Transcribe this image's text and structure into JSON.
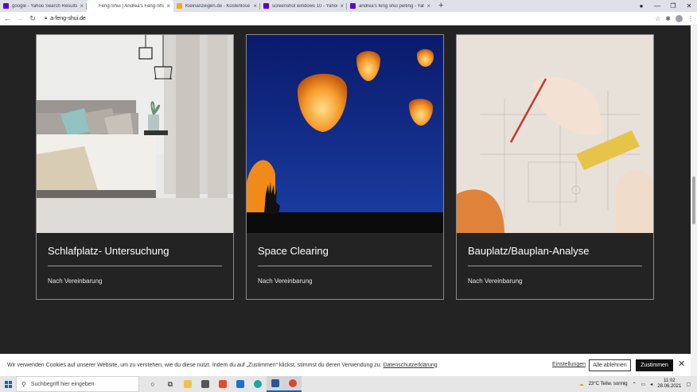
{
  "browser": {
    "tabs": [
      {
        "title": "google - Yahoo Search Results Yc",
        "icon": "yahoo-favicon",
        "active": false
      },
      {
        "title": "Feng-Shui | Andrea's Feng-Shui-",
        "icon": "site-favicon",
        "active": true
      },
      {
        "title": "Kleinanzeigen.de - Kostenlose Kl",
        "icon": "kleinanzeigen-favicon",
        "active": false
      },
      {
        "title": "screenshot windows 10 - Yahoo",
        "icon": "yahoo-favicon",
        "active": false
      },
      {
        "title": "andrea's feng shui peiting - Yaho",
        "icon": "yahoo-favicon",
        "active": false
      }
    ],
    "new_tab": "+",
    "url": "a-feng-shui.de"
  },
  "cards": [
    {
      "title": "Schlafplatz- Untersuchung",
      "subtitle": "Nach Vereinbarung",
      "image": "bedroom-photo"
    },
    {
      "title": "Space Clearing",
      "subtitle": "Nach Vereinbarung",
      "image": "sky-lanterns-photo"
    },
    {
      "title": "Bauplatz/Bauplan-Analyse",
      "subtitle": "Nach Vereinbarung",
      "image": "blueprint-photo"
    }
  ],
  "cookie": {
    "text": "Wir verwenden Cookies auf unserer Website, um zu verstehen, wie du diese nutzt. Indem du auf „Zustimmen“ klickst, stimmst du deren Verwendung zu.",
    "privacy_link": "Datenschutzerklärung",
    "settings": "Einstellungen",
    "reject": "Alle ablehnen",
    "accept": "Zustimmen"
  },
  "taskbar": {
    "search_placeholder": "Suchbegriff hier eingeben",
    "weather": "23°C  Teilw. sonnig",
    "time": "11:02",
    "date": "28.06.2021"
  },
  "colors": {
    "page_bg": "#232323",
    "accent": "#0a64c4"
  }
}
